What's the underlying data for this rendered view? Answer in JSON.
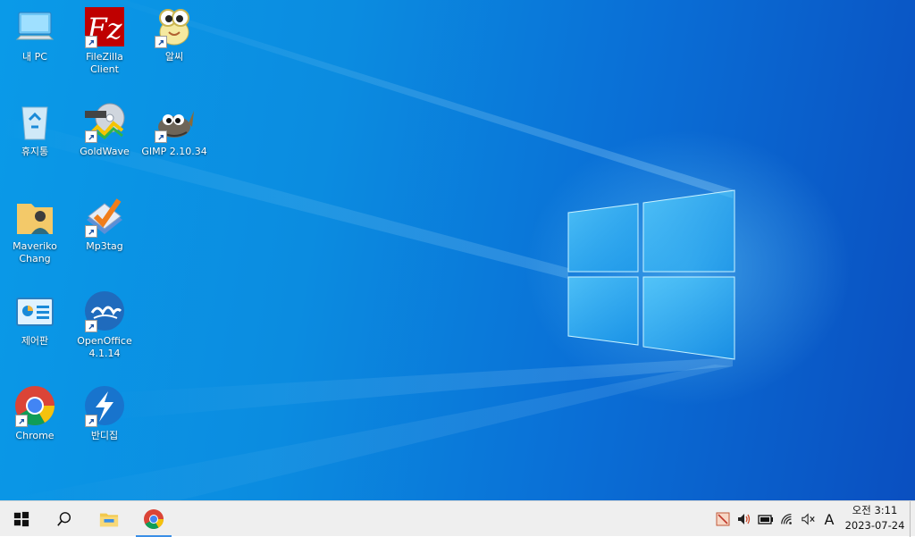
{
  "desktop": {
    "icons": [
      {
        "label": "내 PC",
        "icon": "this-pc-icon",
        "shortcut": false
      },
      {
        "label": "FileZilla\nClient",
        "icon": "filezilla-icon",
        "shortcut": true
      },
      {
        "label": "알씨",
        "icon": "alsee-icon",
        "shortcut": true
      },
      {
        "label": "휴지통",
        "icon": "recycle-bin-icon",
        "shortcut": false
      },
      {
        "label": "GoldWave",
        "icon": "goldwave-icon",
        "shortcut": true
      },
      {
        "label": "GIMP 2.10.34",
        "icon": "gimp-icon",
        "shortcut": true
      },
      {
        "label": "Maveriko\nChang",
        "icon": "user-folder-icon",
        "shortcut": false
      },
      {
        "label": "Mp3tag",
        "icon": "mp3tag-icon",
        "shortcut": true
      },
      {
        "label": "제어판",
        "icon": "control-panel-icon",
        "shortcut": false
      },
      {
        "label": "OpenOffice\n4.1.14",
        "icon": "openoffice-icon",
        "shortcut": true
      },
      {
        "label": "Chrome",
        "icon": "chrome-icon",
        "shortcut": true
      },
      {
        "label": "반디집",
        "icon": "bandizip-icon",
        "shortcut": true
      }
    ]
  },
  "taskbar": {
    "buttons": [
      {
        "icon": "windows-start-icon"
      },
      {
        "icon": "search-icon"
      },
      {
        "icon": "file-explorer-icon"
      },
      {
        "icon": "chrome-icon",
        "active": true
      }
    ],
    "tray": [
      {
        "icon": "blocked-app-icon"
      },
      {
        "icon": "speaker-icon"
      },
      {
        "icon": "battery-icon"
      },
      {
        "icon": "network-icon"
      },
      {
        "icon": "mute-icon"
      },
      {
        "icon": "input-mode-icon",
        "text": "A"
      }
    ],
    "clock": {
      "time": "오전 3:11",
      "date": "2023-07-24"
    }
  },
  "colors": {
    "accent": "#3a8ee6",
    "desktop": "#0a8de2",
    "taskbar": "#efefef"
  }
}
